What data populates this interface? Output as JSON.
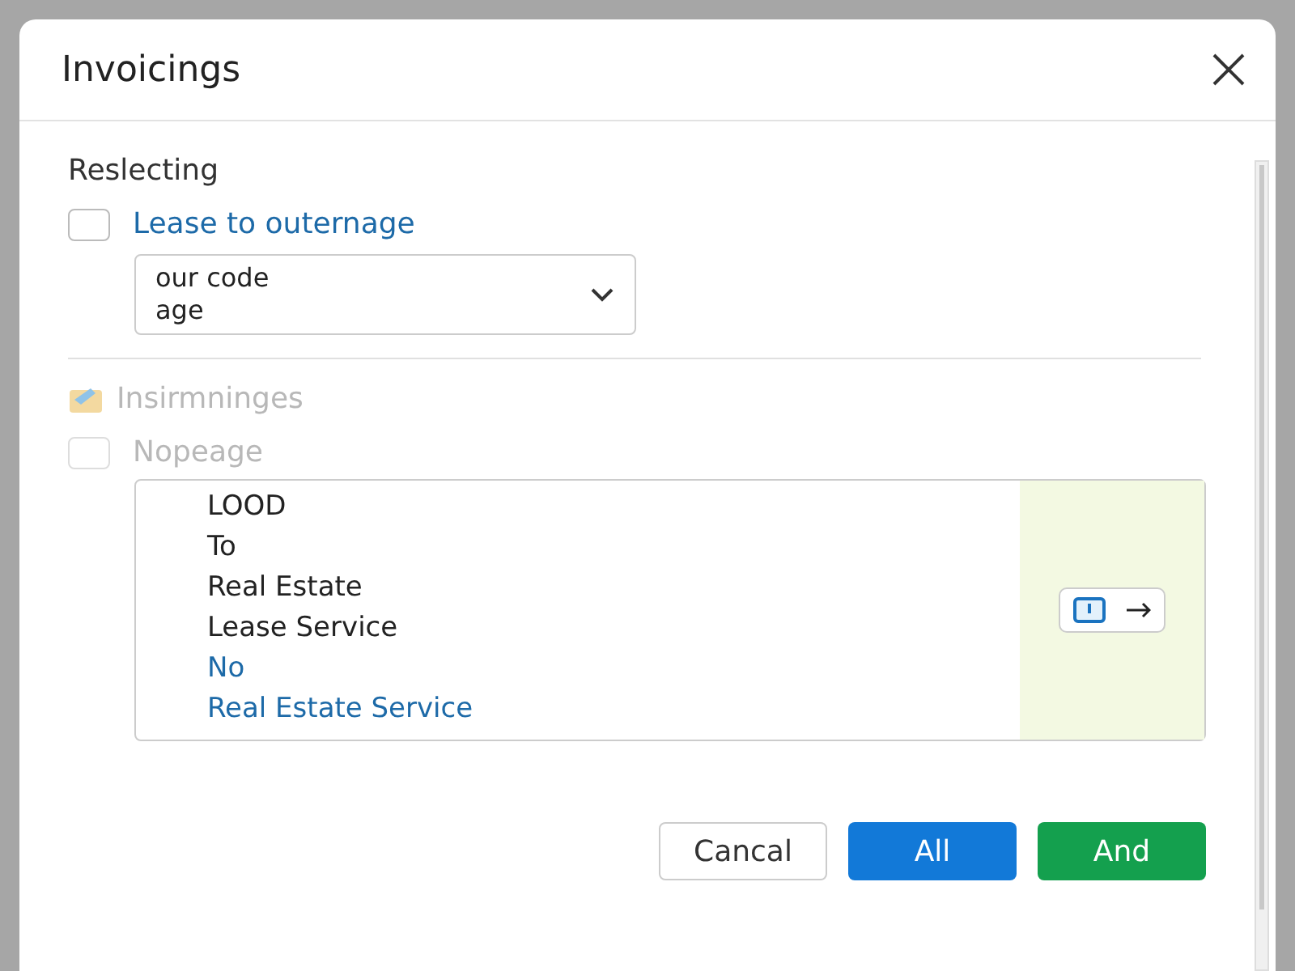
{
  "dialog": {
    "title": "Invoicings"
  },
  "sections": [
    {
      "heading": "Reslecting",
      "disabled": false,
      "checkbox": {
        "label": "Lease to outernage",
        "checked": false
      },
      "select": {
        "lines": [
          "our code",
          "age"
        ]
      }
    },
    {
      "heading": "Insirmninges",
      "disabled": true,
      "checkbox": {
        "label": "Nopeage",
        "checked": false
      }
    }
  ],
  "list": {
    "items": [
      {
        "label": "LOOD",
        "kind": "plain"
      },
      {
        "label": "To",
        "kind": "plain"
      },
      {
        "label": "Real Estate",
        "kind": "plain"
      },
      {
        "label": "Lease Service",
        "kind": "plain"
      },
      {
        "label": "No",
        "kind": "link"
      },
      {
        "label": "Real Estate Service",
        "kind": "link"
      }
    ]
  },
  "buttons": [
    {
      "label": "Cancal",
      "kind": "secondary"
    },
    {
      "label": "All",
      "kind": "primary"
    },
    {
      "label": "And",
      "kind": "success"
    }
  ]
}
